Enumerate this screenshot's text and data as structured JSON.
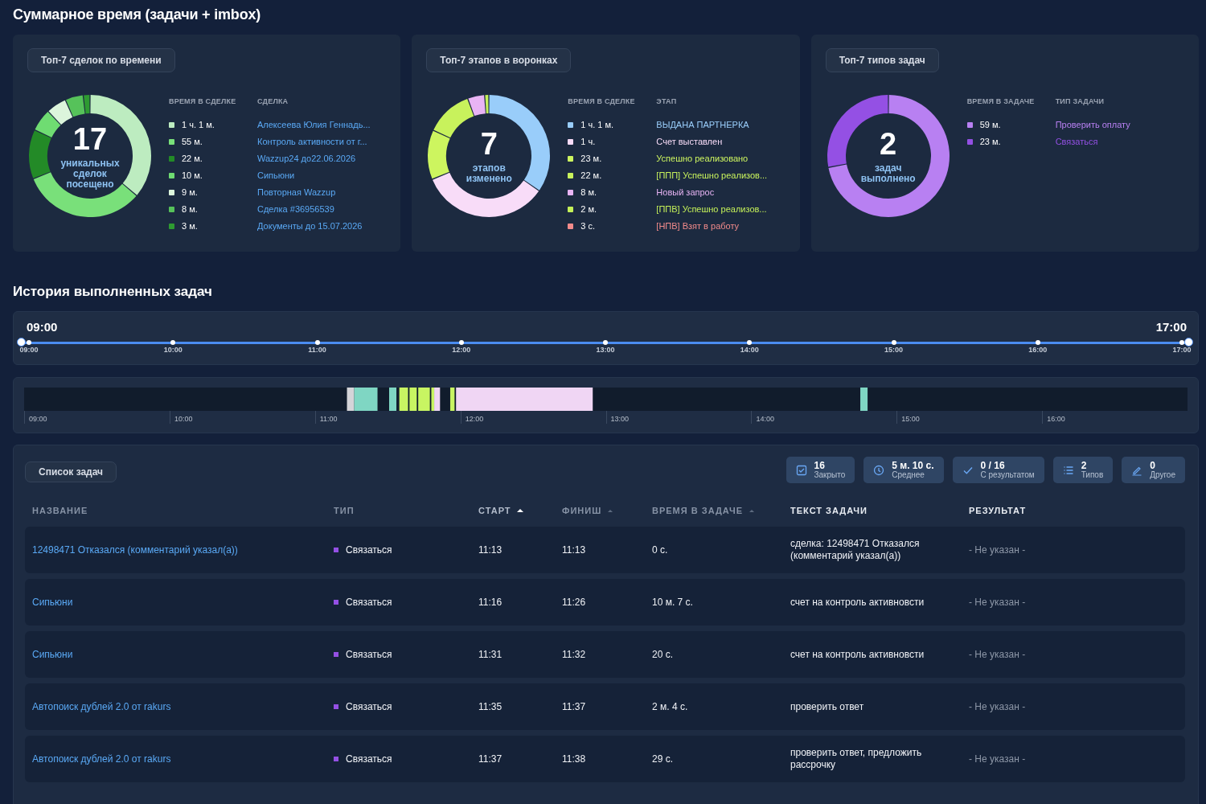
{
  "section_title": "Суммарное время (задачи + imbox)",
  "cards": [
    {
      "title": "Топ-7 сделок по времени",
      "center_value": "17",
      "center_label": "уникальных сделок посещено",
      "col_time": "ВРЕМЯ В СДЕЛКЕ",
      "col_name": "СДЕЛКА",
      "names_colored": false,
      "chart_data": {
        "type": "donut",
        "values": [
          36.2,
          32.7,
          13.1,
          6.0,
          5.4,
          4.8,
          1.8
        ]
      },
      "items": [
        {
          "time": "1 ч. 1 м.",
          "name": "Алексеева Юлия Геннадь...",
          "color": "#bdecc0"
        },
        {
          "time": "55 м.",
          "name": "Контроль активности от г...",
          "color": "#79e07a"
        },
        {
          "time": "22 м.",
          "name": "Wazzup24 до22.06.2026",
          "color": "#238a27"
        },
        {
          "time": "10 м.",
          "name": "Сипьюни",
          "color": "#6fdc72"
        },
        {
          "time": "9 м.",
          "name": "Повторная Wazzup",
          "color": "#dcf5dc"
        },
        {
          "time": "8 м.",
          "name": "Сделка #36956539",
          "color": "#56c25a"
        },
        {
          "time": "3 м.",
          "name": "Документы до 15.07.2026",
          "color": "#2e9a31"
        }
      ]
    },
    {
      "title": "Топ-7 этапов в воронках",
      "center_value": "7",
      "center_label": "этапов изменено",
      "col_time": "ВРЕМЯ В СДЕЛКЕ",
      "col_name": "ЭТАП",
      "names_colored": true,
      "chart_data": {
        "type": "donut",
        "values": [
          34.6,
          34.1,
          13.1,
          12.5,
          4.5,
          1.1,
          null
        ]
      },
      "items": [
        {
          "time": "1 ч. 1 м.",
          "name": "ВЫДАНА ПАРТНЕРКА",
          "color": "#99cdfa"
        },
        {
          "time": "1 ч.",
          "name": "Счет выставлен",
          "color": "#f8dcf8"
        },
        {
          "time": "23 м.",
          "name": "Успешно реализовано",
          "color": "#cdf55f"
        },
        {
          "time": "22 м.",
          "name": "[ППП] Успешно реализов...",
          "color": "#c8f25c"
        },
        {
          "time": "8 м.",
          "name": "Новый запрос",
          "color": "#e8b4f4"
        },
        {
          "time": "2 м.",
          "name": "[ППВ] Успешно реализов...",
          "color": "#c4f058"
        },
        {
          "time": "3 с.",
          "name": "[НПВ] Взят в работу",
          "color": "#f28b8b"
        }
      ]
    },
    {
      "title": "Топ-7 типов задач",
      "center_value": "2",
      "center_label": "задач выполнено",
      "col_time": "ВРЕМЯ В ЗАДАЧЕ",
      "col_name": "ТИП ЗАДАЧИ",
      "names_colored": true,
      "chart_data": {
        "type": "donut",
        "values": [
          72,
          28
        ]
      },
      "items": [
        {
          "time": "59 м.",
          "name": "Проверить оплату",
          "color": "#b880f2"
        },
        {
          "time": "23 м.",
          "name": "Связаться",
          "color": "#9450e4"
        }
      ]
    }
  ],
  "history_title": "История выполненных задач",
  "range": {
    "start_label": "09:00",
    "end_label": "17:00",
    "handles": [
      {
        "level": 0
      },
      {
        "level": 1
      }
    ],
    "ticks": [
      "09:00",
      "10:00",
      "11:00",
      "12:00",
      "13:00",
      "14:00",
      "15:00",
      "16:00",
      "17:00"
    ]
  },
  "timeline": {
    "ticks": [
      "09:00",
      "10:00",
      "11:00",
      "12:00",
      "13:00",
      "14:00",
      "15:00",
      "16:00"
    ]
  },
  "tasks": {
    "title": "Список задач",
    "stats": [
      {
        "kind": "closed",
        "value": "16",
        "label": "Закрыто"
      },
      {
        "kind": "clock",
        "value": "5 м. 10 с.",
        "label": "Среднее"
      },
      {
        "kind": "check",
        "value": "0 / 16",
        "label": "С результатом"
      },
      {
        "kind": "list",
        "value": "2",
        "label": "Типов"
      },
      {
        "kind": "pencil",
        "value": "0",
        "label": "Другое"
      }
    ],
    "columns": [
      {
        "label": "НАЗВАНИЕ",
        "sortable": false
      },
      {
        "label": "ТИП",
        "sortable": false
      },
      {
        "label": "СТАРТ",
        "sortable": true,
        "sorted": true
      },
      {
        "label": "ФИНИШ",
        "sortable": true,
        "sorted": false
      },
      {
        "label": "ВРЕМЯ В ЗАДАЧЕ",
        "sortable": true,
        "sorted": false
      },
      {
        "label": "ТЕКСТ ЗАДАЧИ",
        "sortable": false
      },
      {
        "label": "РЕЗУЛЬТАТ",
        "sortable": false
      }
    ],
    "rows": [
      {
        "name": "12498471 Отказался (комментарий указал(а))",
        "type": "Связаться",
        "color": "#9450e4",
        "start": "11:13",
        "finish": "11:13",
        "duration": "0 с.",
        "text": "сделка: 12498471 Отказался (комментарий указал(а))",
        "result": "- Не указан -"
      },
      {
        "name": "Сипьюни",
        "type": "Связаться",
        "color": "#9450e4",
        "start": "11:16",
        "finish": "11:26",
        "duration": "10 м. 7 с.",
        "text": "счет на контроль активновсти",
        "result": "- Не указан -"
      },
      {
        "name": "Сипьюни",
        "type": "Связаться",
        "color": "#9450e4",
        "start": "11:31",
        "finish": "11:32",
        "duration": "20 с.",
        "text": "счет на контроль активновсти",
        "result": "- Не указан -"
      },
      {
        "name": "Автопоиск дублей 2.0 от rakurs",
        "type": "Связаться",
        "color": "#9450e4",
        "start": "11:35",
        "finish": "11:37",
        "duration": "2 м. 4 с.",
        "text": "проверить ответ",
        "result": "- Не указан -"
      },
      {
        "name": "Автопоиск дублей 2.0 от rakurs",
        "type": "Связаться",
        "color": "#9450e4",
        "start": "11:37",
        "finish": "11:38",
        "duration": "29 с.",
        "text": "проверить ответ, предложить рассрочку",
        "result": "- Не указан -"
      }
    ]
  }
}
